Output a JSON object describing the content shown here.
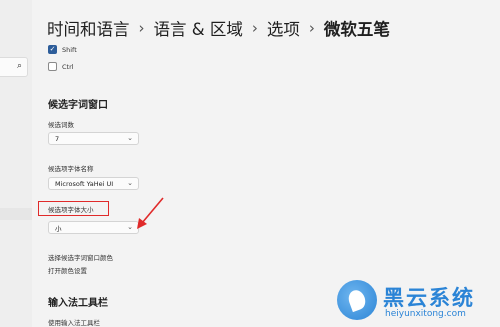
{
  "breadcrumb": {
    "items": [
      "时间和语言",
      "语言 & 区域",
      "选项"
    ],
    "current": "微软五笔",
    "separator": "›"
  },
  "sidebar": {
    "search_icon": "search-icon"
  },
  "checkboxes": [
    {
      "label": "Shift",
      "checked": true
    },
    {
      "label": "Ctrl",
      "checked": false
    }
  ],
  "candidate_window": {
    "title": "候选字词窗口",
    "count_label": "候选词数",
    "count_value": "7",
    "font_label": "候选项字体名称",
    "font_value": "Microsoft YaHei UI",
    "size_label": "候选项字体大小",
    "size_value": "小",
    "color_label": "选择候选字词窗口颜色",
    "color_link": "打开颜色设置"
  },
  "toolbar_section": {
    "title": "输入法工具栏",
    "use_label": "使用输入法工具栏"
  },
  "watermark": {
    "title": "黑云系统",
    "url": "heiyunxitong.com"
  },
  "colors": {
    "accent": "#2d5d9a",
    "annotation": "#e02a2a",
    "watermark": "#2b84d6"
  }
}
